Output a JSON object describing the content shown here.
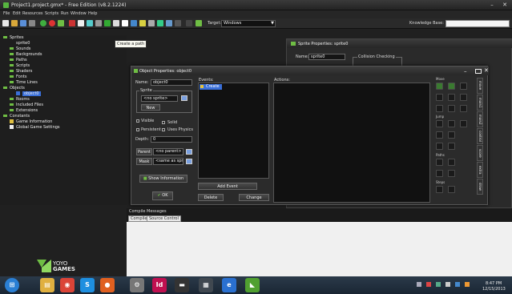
{
  "window": {
    "title": "Project1.project.gmx* - Free Edition (v8.2.1224)",
    "minimize": "–",
    "close": "✕"
  },
  "menu": [
    "File",
    "Edit",
    "Resources",
    "Scripts",
    "Run",
    "Window",
    "Help"
  ],
  "toolbar": {
    "target_label": "Target:",
    "target_value": "Windows",
    "knowledge_base_label": "Knowledge Base:"
  },
  "tooltip": "Create a path",
  "tree": {
    "items": [
      {
        "label": "Sprites",
        "indent": 0,
        "icon": "folder-icon",
        "selected": false
      },
      {
        "label": "sprite0",
        "indent": 2,
        "icon": "none",
        "selected": false
      },
      {
        "label": "Sounds",
        "indent": 1,
        "icon": "folder-icon",
        "selected": false
      },
      {
        "label": "Backgrounds",
        "indent": 1,
        "icon": "folder-icon",
        "selected": false
      },
      {
        "label": "Paths",
        "indent": 1,
        "icon": "folder-icon",
        "selected": false
      },
      {
        "label": "Scripts",
        "indent": 1,
        "icon": "folder-icon",
        "selected": false
      },
      {
        "label": "Shaders",
        "indent": 1,
        "icon": "folder-icon",
        "selected": false
      },
      {
        "label": "Fonts",
        "indent": 1,
        "icon": "folder-icon",
        "selected": false
      },
      {
        "label": "Time Lines",
        "indent": 1,
        "icon": "folder-icon",
        "selected": false
      },
      {
        "label": "Objects",
        "indent": 0,
        "icon": "folder-icon",
        "selected": false
      },
      {
        "label": "object0",
        "indent": 2,
        "icon": "object-icon",
        "selected": true
      },
      {
        "label": "Rooms",
        "indent": 1,
        "icon": "folder-icon",
        "selected": false
      },
      {
        "label": "Included Files",
        "indent": 1,
        "icon": "folder-icon",
        "selected": false
      },
      {
        "label": "Extensions",
        "indent": 1,
        "icon": "folder-icon",
        "selected": false
      },
      {
        "label": "Constants",
        "indent": 0,
        "icon": "folder-icon",
        "selected": false
      },
      {
        "label": "Game Information",
        "indent": 1,
        "icon": "info-icon",
        "selected": false
      },
      {
        "label": "Global Game Settings",
        "indent": 1,
        "icon": "settings-icon",
        "selected": false
      }
    ]
  },
  "sprite_window": {
    "title": "Sprite Properties: sprite0",
    "name_label": "Name:",
    "name_value": "sprite0",
    "collision_label": "Collision Checking"
  },
  "object_window": {
    "title": "Object Properties: object0",
    "name_label": "Name:",
    "name_value": "object0",
    "sprite_group": "Sprite",
    "sprite_value": "<no sprite>",
    "new_button": "New",
    "visible_label": "Visible",
    "solid_label": "Solid",
    "persistent_label": "Persistent",
    "physics_label": "Uses Physics",
    "depth_label": "Depth:",
    "depth_value": "0",
    "parent_button": "Parent",
    "parent_value": "<no parent>",
    "mask_button": "Mask",
    "mask_value": "<same as sprite>",
    "show_info_button": "Show Information",
    "ok_button": "OK",
    "events_label": "Events:",
    "events": [
      "Create"
    ],
    "actions_label": "Actions:",
    "add_event_button": "Add Event",
    "delete_button": "Delete",
    "change_button": "Change",
    "palette": {
      "move_label": "Move",
      "jump_label": "Jump",
      "paths_label": "Paths",
      "steps_label": "Steps"
    },
    "side_tabs": [
      "move",
      "main1",
      "main2",
      "control",
      "score",
      "extra",
      "draw"
    ]
  },
  "messages": {
    "title": "Compile Messages",
    "tab_compile": "Compile",
    "tab_source": "Source Control"
  },
  "logo": {
    "line1": "YOYO",
    "line2": "GAMES"
  },
  "taskbar": {
    "icons": [
      {
        "name": "start-orb-icon",
        "glyph": "⊞",
        "color": "#2a7fd4"
      },
      {
        "name": "explorer-icon",
        "glyph": "▤",
        "color": "#e0b040"
      },
      {
        "name": "chrome-icon",
        "glyph": "◉",
        "color": "#db4437"
      },
      {
        "name": "skype-icon",
        "glyph": "S",
        "color": "#1e8fe0"
      },
      {
        "name": "firefox-icon",
        "glyph": "●",
        "color": "#e06020"
      },
      {
        "name": "app-gear-icon",
        "glyph": "⚙",
        "color": "#777777"
      },
      {
        "name": "indesign-icon",
        "glyph": "Id",
        "color": "#c01050"
      },
      {
        "name": "terminal-icon",
        "glyph": "▬",
        "color": "#333333"
      },
      {
        "name": "calculator-icon",
        "glyph": "▦",
        "color": "#404850"
      },
      {
        "name": "ie-icon",
        "glyph": "e",
        "color": "#2a70d0"
      },
      {
        "name": "gamemaker-icon",
        "glyph": "◣",
        "color": "#50a030"
      }
    ],
    "time": "8:47 PM",
    "date": "12/15/2013"
  },
  "colors": {
    "accent_green": "#6fbe44",
    "selection_blue": "#3a6fd8"
  }
}
